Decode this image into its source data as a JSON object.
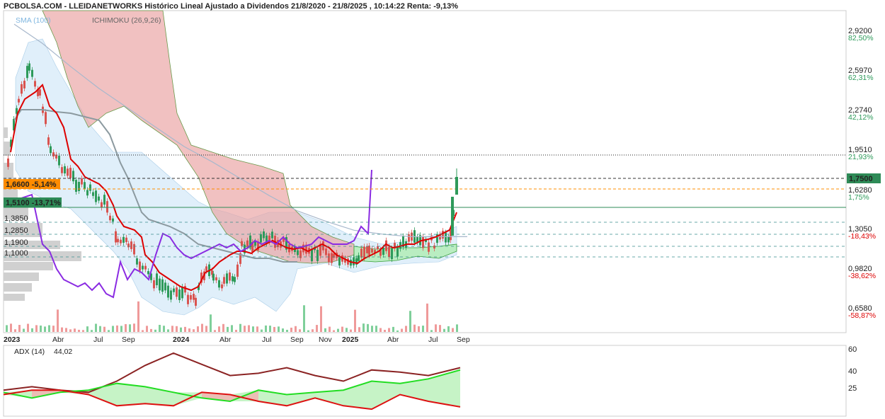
{
  "title": "PCBOLSA.COM - LLEIDANETWORKS Histórico Lineal Ajustado a Dividendos 21/8/2020 - 21/8/2025 , 10:14:22 Renta: -9,13%",
  "legend": {
    "sma": "SMA (100)",
    "ichimoku": "ICHIMOKU (26,9,26)",
    "adx": "ADX (14)",
    "adx_value": "44,02"
  },
  "colors": {
    "price_red": "#dd0000",
    "ma_gray": "#8c9aa0",
    "sma_blue": "#a8b8cc",
    "purple": "#8a2be2",
    "cloud_red": "#eeaaaa",
    "cloud_green": "#aaeeaa",
    "bollinger": "#cfe7f7",
    "candle_up": "#2e9a5a",
    "candle_down": "#d9534f",
    "adx_dark": "#8b2323",
    "adx_green": "#22dd22",
    "adx_red": "#dd1111",
    "label_orange": "#ff8c00",
    "label_green": "#2e8b57",
    "label_darkgreen": "#1a7a3a"
  },
  "chart_data": {
    "type": "line",
    "title": "PCBOLSA.COM - LLEIDANETWORKS Histórico Lineal Ajustado a Dividendos 21/8/2020 - 21/8/2025 , 10:14:22 Renta: -9,13%",
    "x_ticks": [
      "2023",
      "Abr",
      "Jul",
      "Sep",
      "2024",
      "Abr",
      "Jul",
      "Sep",
      "Nov",
      "2025",
      "Abr",
      "Jul",
      "Sep"
    ],
    "y_ticks_right": [
      {
        "price": "2,9200",
        "pct": "82,50%"
      },
      {
        "price": "2,5970",
        "pct": "62,31%"
      },
      {
        "price": "2,2740",
        "pct": "42,12%"
      },
      {
        "price": "1,9510",
        "pct": "21,93%"
      },
      {
        "price": "1,6280",
        "pct": "1,75%"
      },
      {
        "price": "1,3050",
        "pct": "-18,43%"
      },
      {
        "price": "0,9820",
        "pct": "-38,62%"
      },
      {
        "price": "0,6580",
        "pct": "-58,87%"
      }
    ],
    "current_price": "1,7500",
    "reference_levels": [
      {
        "label": "1,6600  -5,14%",
        "value": 1.66
      },
      {
        "label": "1,5100  -13,71%",
        "value": 1.51
      }
    ],
    "support_levels": [
      "1,3850",
      "1,2850",
      "1,1900",
      "1,1000"
    ],
    "ylim": [
      0.5,
      3.0
    ],
    "series": [
      {
        "name": "SMA (100)",
        "x": [
          0,
          40,
          80,
          120,
          160,
          200,
          240,
          280,
          320,
          360,
          400,
          440,
          480,
          520,
          560,
          600,
          640
        ],
        "values": [
          2.95,
          2.8,
          2.62,
          2.45,
          2.3,
          2.15,
          2.0,
          1.88,
          1.75,
          1.62,
          1.5,
          1.42,
          1.35,
          1.32,
          1.3,
          1.3,
          1.3
        ]
      },
      {
        "name": "ICHIMOKU (26,9,26)",
        "x": [
          0,
          20,
          40,
          60,
          80,
          100,
          120,
          140,
          160,
          180,
          200,
          220,
          240,
          260,
          280,
          300,
          320,
          340,
          360,
          380,
          400,
          420,
          440,
          460,
          480,
          500,
          520,
          540,
          560,
          580,
          600,
          620,
          640,
          650
        ],
        "values": [
          2.0,
          2.6,
          2.35,
          2.4,
          2.15,
          1.75,
          1.6,
          1.65,
          1.48,
          1.3,
          1.25,
          1.12,
          1.0,
          0.85,
          1.05,
          1.1,
          1.08,
          1.06,
          1.15,
          1.22,
          1.1,
          1.13,
          1.08,
          1.05,
          1.1,
          1.05,
          1.15,
          1.12,
          1.25,
          1.2,
          1.28,
          1.35,
          1.55,
          1.78
        ]
      }
    ],
    "adx": {
      "ylim": [
        0,
        60
      ],
      "y_ticks": [
        "60",
        "40",
        "25"
      ],
      "x": [
        0,
        40,
        80,
        120,
        160,
        200,
        240,
        280,
        320,
        360,
        400,
        440,
        480,
        520,
        560,
        600,
        645
      ],
      "adx": [
        22,
        25,
        22,
        20,
        30,
        44,
        55,
        45,
        35,
        37,
        42,
        35,
        30,
        40,
        38,
        35,
        42
      ],
      "di_plus": [
        20,
        15,
        20,
        22,
        28,
        25,
        20,
        15,
        12,
        22,
        18,
        20,
        22,
        30,
        28,
        32,
        40
      ],
      "di_minus": [
        18,
        22,
        22,
        18,
        8,
        10,
        8,
        20,
        18,
        12,
        8,
        15,
        8,
        5,
        18,
        12,
        7
      ]
    }
  }
}
